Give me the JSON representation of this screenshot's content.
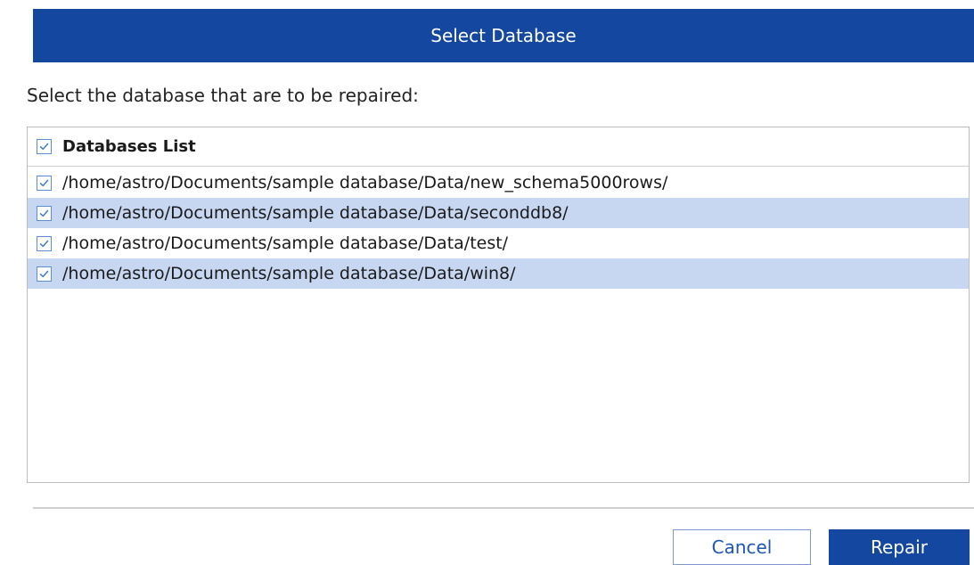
{
  "dialog": {
    "title": "Select Database",
    "instruction": "Select the database that are to be repaired:",
    "accent_color": "#1447a0",
    "selection_color": "#c7d7f2"
  },
  "list": {
    "header_label": "Databases List",
    "header_checked": true,
    "items": [
      {
        "path": "/home/astro/Documents/sample database/Data/new_schema5000rows/",
        "checked": true,
        "highlighted": false
      },
      {
        "path": "/home/astro/Documents/sample database/Data/seconddb8/",
        "checked": true,
        "highlighted": true
      },
      {
        "path": "/home/astro/Documents/sample database/Data/test/",
        "checked": true,
        "highlighted": false
      },
      {
        "path": "/home/astro/Documents/sample database/Data/win8/",
        "checked": true,
        "highlighted": true
      }
    ]
  },
  "buttons": {
    "cancel_label": "Cancel",
    "repair_label": "Repair"
  },
  "icons": {
    "checkbox": "checkbox-checked-icon"
  }
}
